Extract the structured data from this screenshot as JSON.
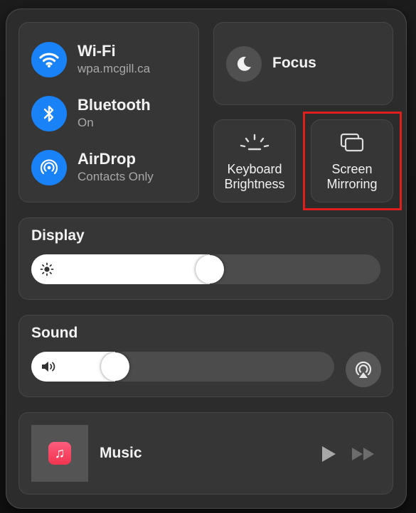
{
  "connectivity": {
    "wifi": {
      "title": "Wi-Fi",
      "subtitle": "wpa.mcgill.ca",
      "icon": "wifi-icon"
    },
    "bluetooth": {
      "title": "Bluetooth",
      "subtitle": "On",
      "icon": "bluetooth-icon"
    },
    "airdrop": {
      "title": "AirDrop",
      "subtitle": "Contacts Only",
      "icon": "airdrop-icon"
    }
  },
  "focus": {
    "label": "Focus",
    "icon": "moon-icon"
  },
  "keyboard_brightness": {
    "line1": "Keyboard",
    "line2": "Brightness",
    "icon": "keyboard-brightness-icon"
  },
  "screen_mirroring": {
    "line1": "Screen",
    "line2": "Mirroring",
    "icon": "screen-mirroring-icon"
  },
  "display": {
    "label": "Display",
    "brightness_fraction": 0.47,
    "icon": "sun-icon"
  },
  "sound": {
    "label": "Sound",
    "volume_fraction": 0.23,
    "icon": "speaker-icon",
    "output_icon": "airplay-audio-icon"
  },
  "music": {
    "label": "Music",
    "app_icon": "music-note-icon",
    "play_icon": "play-icon",
    "next_icon": "fast-forward-icon"
  },
  "colors": {
    "accent": "#1a82f7",
    "highlight": "#e01e1e",
    "panel": "#2c2c2c"
  }
}
